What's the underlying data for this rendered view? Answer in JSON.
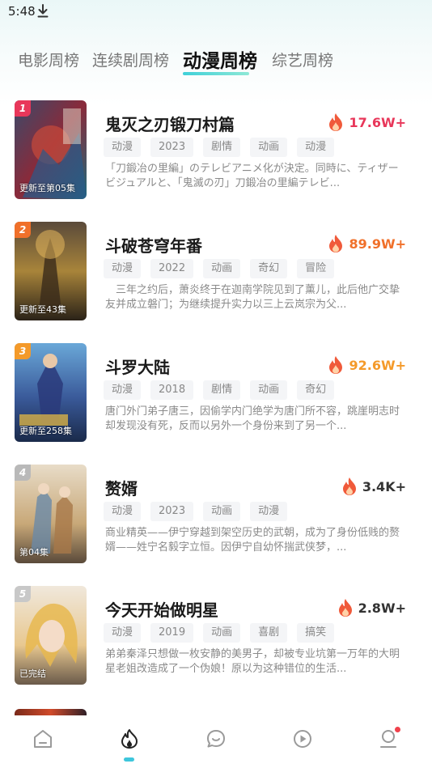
{
  "status_bar": {
    "time": "5:48"
  },
  "tabs": [
    {
      "label": "电影周榜",
      "active": false
    },
    {
      "label": "连续剧周榜",
      "active": false
    },
    {
      "label": "动漫周榜",
      "active": true
    },
    {
      "label": "综艺周榜",
      "active": false
    }
  ],
  "items": [
    {
      "rank": "1",
      "badge_color": "#e8375a",
      "episodes": "更新至第05集",
      "title": "鬼灭之刃锻刀村篇",
      "heat": "17.6W+",
      "heat_color": "#e8375a",
      "tags": [
        "动漫",
        "2023",
        "剧情",
        "动画",
        "动漫"
      ],
      "desc": "「刀鍛冶の里編」のテレビアニメ化が決定。同時に、ティザービジュアルと、「鬼滅の刃」刀鍛冶の里編テレビ..."
    },
    {
      "rank": "2",
      "badge_color": "#f0702a",
      "episodes": "更新至43集",
      "title": "斗破苍穹年番",
      "heat": "89.9W+",
      "heat_color": "#f0702a",
      "tags": [
        "动漫",
        "2022",
        "动画",
        "奇幻",
        "冒险"
      ],
      "desc": "　三年之约后，萧炎终于在迦南学院见到了薰儿，此后他广交挚友并成立磐门；为继续提升实力以三上云岚宗为父..."
    },
    {
      "rank": "3",
      "badge_color": "#f49a2a",
      "episodes": "更新至258集",
      "title": "斗罗大陆",
      "heat": "92.6W+",
      "heat_color": "#f49a2a",
      "tags": [
        "动漫",
        "2018",
        "剧情",
        "动画",
        "奇幻"
      ],
      "desc": "唐门外门弟子唐三，因偷学内门绝学为唐门所不容，跳崖明志时却发现没有死，反而以另外一个身份来到了另一个..."
    },
    {
      "rank": "4",
      "badge_color": "#b9b9b9",
      "episodes": "第04集",
      "title": "赘婿",
      "heat": "3.4K+",
      "heat_color": "#333333",
      "tags": [
        "动漫",
        "2023",
        "动画",
        "动漫"
      ],
      "desc": "商业精英——伊宁穿越到架空历史的武朝，成为了身份低贱的赘婿——姓宁名毅字立恒。因伊宁自幼怀揣武侠梦，..."
    },
    {
      "rank": "5",
      "badge_color": "#c8c8c8",
      "episodes": "已完结",
      "title": "今天开始做明星",
      "heat": "2.8W+",
      "heat_color": "#333333",
      "tags": [
        "动漫",
        "2019",
        "动画",
        "喜剧",
        "搞笑"
      ],
      "desc": "弟弟秦泽只想做一枚安静的美男子，却被专业坑第一万年的大明星老姐改造成了一个伪娘！原以为这种错位的生活..."
    }
  ],
  "bottom_nav": [
    {
      "icon": "home-icon",
      "active": false
    },
    {
      "icon": "flame-icon",
      "active": true
    },
    {
      "icon": "chat-icon",
      "active": false
    },
    {
      "icon": "play-icon",
      "active": false
    },
    {
      "icon": "profile-icon",
      "active": false,
      "badge_dot": true
    }
  ],
  "colors": {
    "accent": "#3ec6dc",
    "hot_red": "#e8375a",
    "hot_orange": "#f0702a"
  }
}
